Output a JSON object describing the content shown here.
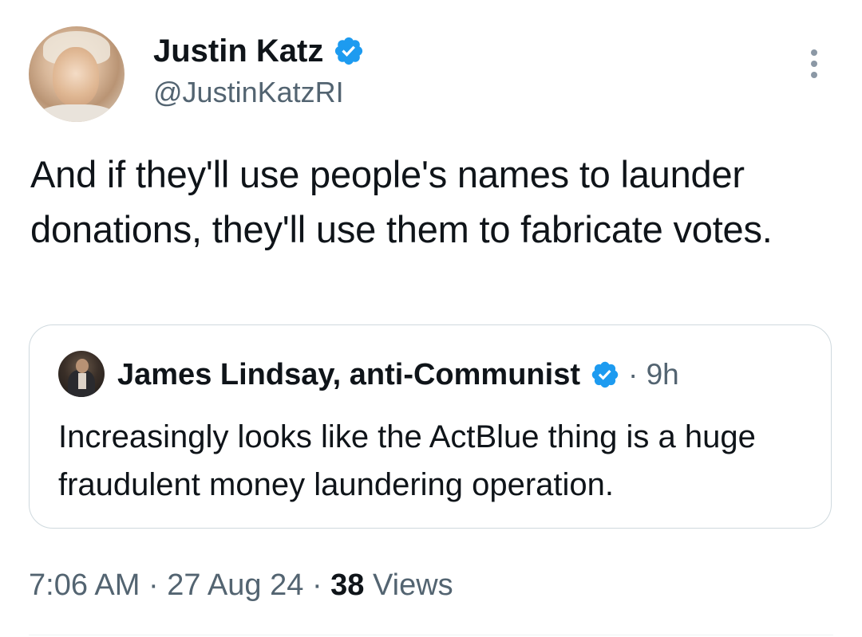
{
  "tweet": {
    "author": {
      "name": "Justin Katz",
      "handle": "@JustinKatzRI",
      "verified": true,
      "avatar_icon": "profile-photo"
    },
    "more_icon": "more-vertical-icon",
    "text": "And if they'll use people's names to launder donations, they'll use them to fabricate votes.",
    "timestamp": "7:06 AM",
    "date": "27 Aug 24",
    "separator": "·",
    "views_count": "38",
    "views_label": "Views"
  },
  "quoted_tweet": {
    "author": {
      "name": "James Lindsay, anti-Communist",
      "verified": true,
      "avatar_icon": "profile-photo"
    },
    "time_ago": "· 9h",
    "text": "Increasingly looks like the ActBlue thing is a huge fraudulent money laundering operation."
  },
  "colors": {
    "verified_blue": "#1d9bf0",
    "text_primary": "#0f1419",
    "text_secondary": "#536471",
    "border": "#cfd9de"
  }
}
